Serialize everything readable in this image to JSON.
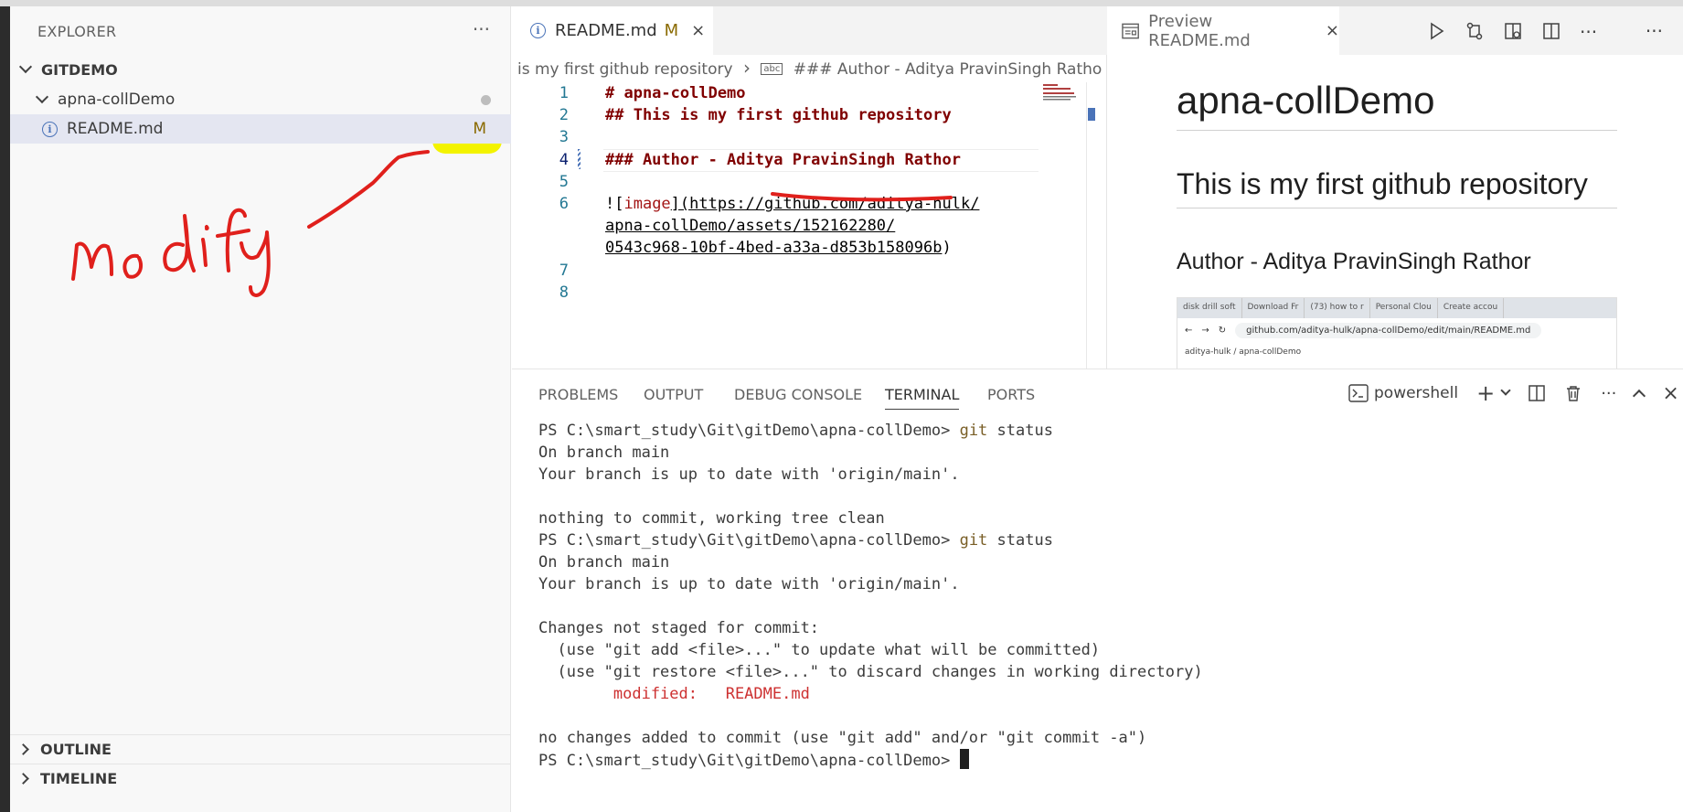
{
  "sidebar": {
    "title": "EXPLORER",
    "more": "···",
    "root": "GITDEMO",
    "folder": "apna-collDemo",
    "file": "README.md",
    "file_badge": "M",
    "outline": "OUTLINE",
    "timeline": "TIMELINE"
  },
  "tabs": {
    "active_label": "README.md",
    "active_badge": "M",
    "preview_label": "Preview README.md",
    "close": "×",
    "more": "···"
  },
  "breadcrumb": {
    "part1": "is my first github repository",
    "sep": "›",
    "abc_icon": "abc",
    "part2": "### Author - Aditya PravinSingh Rathor"
  },
  "editor": {
    "line_numbers": [
      "1",
      "2",
      "3",
      "4",
      "5",
      "6",
      "7",
      "8"
    ],
    "lines": {
      "l1": "# apna-collDemo",
      "l2": "## This is my first github repository",
      "l4": "### Author - Aditya PravinSingh Rathor",
      "l6a_prefix": "![",
      "l6a_alt": "image",
      "l6a_rest": "](https://github.com/aditya-hulk/",
      "l6b": "apna-collDemo/assets/152162280/",
      "l6c": "0543c968-10bf-4bed-a33a-d853b158096b",
      "l6c_end": ")"
    }
  },
  "preview": {
    "h1": "apna-collDemo",
    "h2": "This is my first github repository",
    "h3": "Author - Aditya PravinSingh Rathor",
    "shot_tabs": [
      "disk drill soft",
      "Download Fr",
      "(73) how to r",
      "Personal Clou",
      "Create accou"
    ],
    "shot_url": "github.com/aditya-hulk/apna-collDemo/edit/main/README.md",
    "shot_gh": "aditya-hulk / apna-collDemo"
  },
  "panel": {
    "tabs": [
      "PROBLEMS",
      "OUTPUT",
      "DEBUG CONSOLE",
      "TERMINAL",
      "PORTS"
    ],
    "shell": "powershell",
    "terminal": {
      "prompt": "PS C:\\smart_study\\Git\\gitDemo\\apna-collDemo> ",
      "cmd": "git",
      "arg": " status",
      "o1": "On branch main",
      "o2": "Your branch is up to date with 'origin/main'.",
      "o3": "nothing to commit, working tree clean",
      "o4": "Changes not staged for commit:",
      "o5": "  (use \"git add <file>...\" to update what will be committed)",
      "o6": "  (use \"git restore <file>...\" to discard changes in working directory)",
      "o7_label": "        modified:   ",
      "o7_file": "README.md",
      "o8": "no changes added to commit (use \"git add\" and/or \"git commit -a\")"
    }
  },
  "annotation_text": "modify",
  "colors": {
    "ink": "#e0201c",
    "highlight": "#f3f300",
    "heading_code": "#800000",
    "line_number": "#237893",
    "terminal_cmd": "#795e26",
    "terminal_red": "#cd3131"
  }
}
